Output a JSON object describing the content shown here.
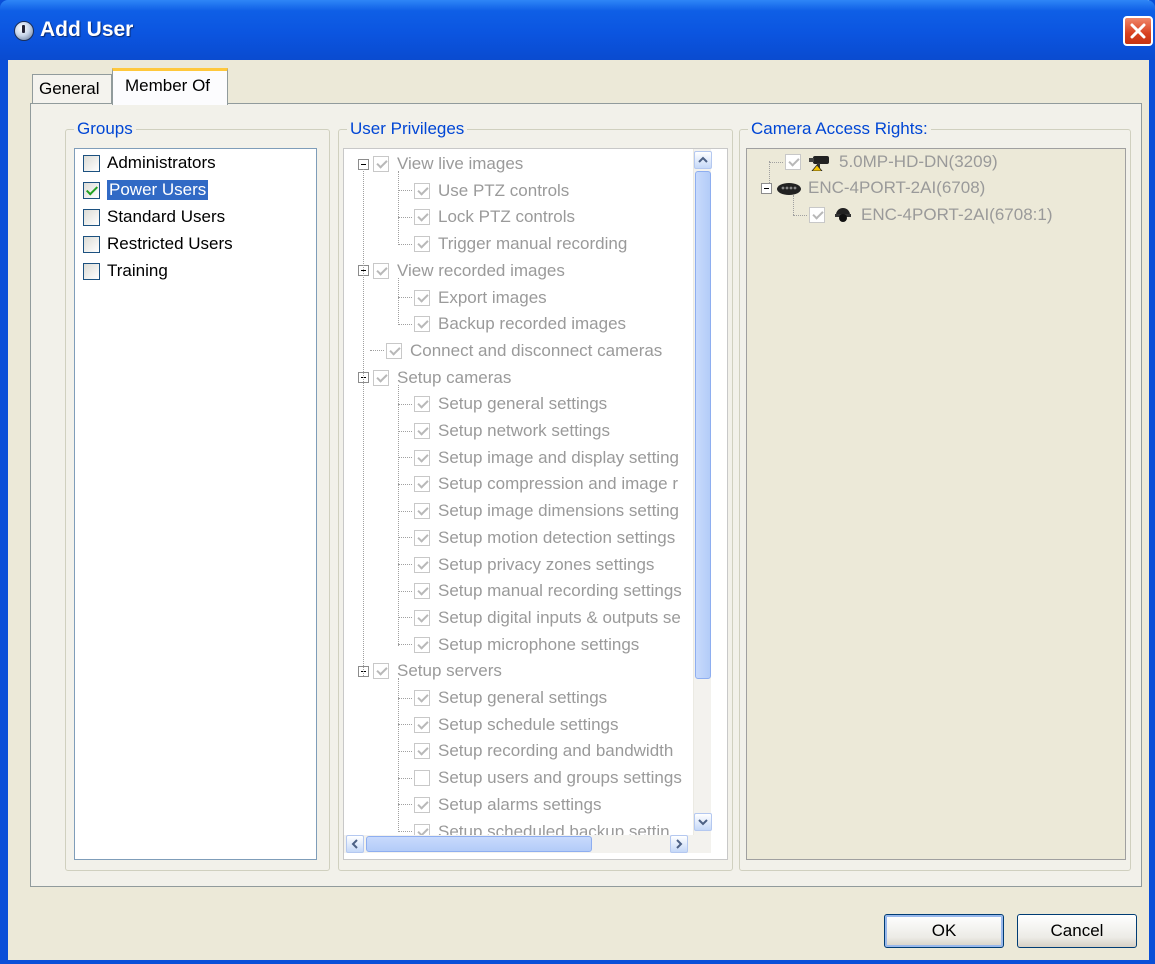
{
  "window": {
    "title": "Add User"
  },
  "tabs": [
    {
      "label": "General",
      "active": false
    },
    {
      "label": "Member Of",
      "active": true
    }
  ],
  "groups": {
    "title": "Groups",
    "items": [
      {
        "label": "Administrators",
        "checked": false,
        "selected": false
      },
      {
        "label": "Power Users",
        "checked": true,
        "selected": true
      },
      {
        "label": "Standard Users",
        "checked": false,
        "selected": false
      },
      {
        "label": "Restricted Users",
        "checked": false,
        "selected": false
      },
      {
        "label": "Training",
        "checked": false,
        "selected": false
      }
    ]
  },
  "privileges": {
    "title": "User Privileges",
    "items": [
      {
        "label": "View live images",
        "level": 0,
        "checked": true
      },
      {
        "label": "Use PTZ controls",
        "level": 1,
        "checked": true
      },
      {
        "label": "Lock PTZ controls",
        "level": 1,
        "checked": true
      },
      {
        "label": "Trigger manual recording",
        "level": 1,
        "checked": true
      },
      {
        "label": "View recorded images",
        "level": 0,
        "checked": true
      },
      {
        "label": "Export images",
        "level": 1,
        "checked": true
      },
      {
        "label": "Backup recorded images",
        "level": 1,
        "checked": true
      },
      {
        "label": "Connect and disconnect cameras",
        "level": 0,
        "checked": true,
        "leaf": true
      },
      {
        "label": "Setup cameras",
        "level": 0,
        "checked": true
      },
      {
        "label": "Setup general settings",
        "level": 1,
        "checked": true
      },
      {
        "label": "Setup network settings",
        "level": 1,
        "checked": true
      },
      {
        "label": "Setup image and display setting",
        "level": 1,
        "checked": true
      },
      {
        "label": "Setup compression and image r",
        "level": 1,
        "checked": true
      },
      {
        "label": "Setup image dimensions setting",
        "level": 1,
        "checked": true
      },
      {
        "label": "Setup motion detection settings",
        "level": 1,
        "checked": true
      },
      {
        "label": "Setup privacy zones settings",
        "level": 1,
        "checked": true
      },
      {
        "label": "Setup manual recording settings",
        "level": 1,
        "checked": true
      },
      {
        "label": "Setup digital inputs & outputs se",
        "level": 1,
        "checked": true
      },
      {
        "label": "Setup microphone settings",
        "level": 1,
        "checked": true
      },
      {
        "label": "Setup servers",
        "level": 0,
        "checked": true
      },
      {
        "label": "Setup general settings",
        "level": 1,
        "checked": true
      },
      {
        "label": "Setup schedule settings",
        "level": 1,
        "checked": true
      },
      {
        "label": "Setup recording and bandwidth",
        "level": 1,
        "checked": true
      },
      {
        "label": "Setup users and groups settings",
        "level": 1,
        "checked": false
      },
      {
        "label": "Setup alarms settings",
        "level": 1,
        "checked": true
      },
      {
        "label": "Setup scheduled backup settin",
        "level": 1,
        "checked": true
      }
    ]
  },
  "cameras": {
    "title": "Camera Access Rights:",
    "items": [
      {
        "label": "5.0MP-HD-DN(3209)",
        "icon": "camera-icon"
      },
      {
        "label": "ENC-4PORT-2AI(6708)",
        "icon": "encoder-icon"
      },
      {
        "label": "ENC-4PORT-2AI(6708:1)",
        "icon": "dome-camera-icon"
      }
    ]
  },
  "buttons": {
    "ok": "OK",
    "cancel": "Cancel"
  },
  "colors": {
    "title_bar": "#0a4fd8",
    "legend": "#0046d5",
    "selection": "#316ac5",
    "dialog_bg": "#ece9d8"
  }
}
